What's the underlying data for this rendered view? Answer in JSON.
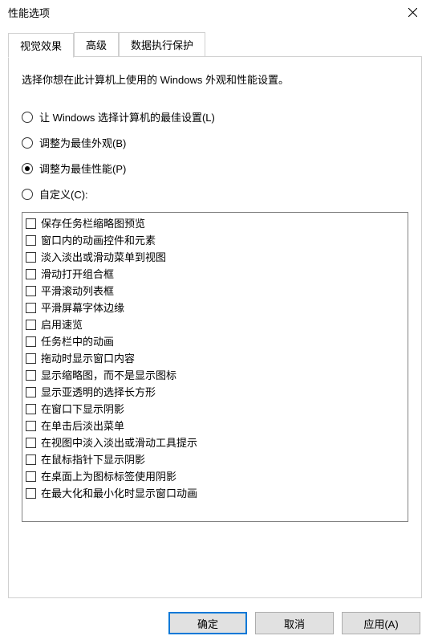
{
  "window": {
    "title": "性能选项"
  },
  "tabs": {
    "visual": "视觉效果",
    "advanced": "高级",
    "dep": "数据执行保护"
  },
  "desc": "选择你想在此计算机上使用的 Windows 外观和性能设置。",
  "radios": {
    "let_windows": "让 Windows 选择计算机的最佳设置(L)",
    "best_appearance": "调整为最佳外观(B)",
    "best_performance": "调整为最佳性能(P)",
    "custom": "自定义(C):",
    "selected": "best_performance"
  },
  "checks": [
    "保存任务栏缩略图预览",
    "窗口内的动画控件和元素",
    "淡入淡出或滑动菜单到视图",
    "滑动打开组合框",
    "平滑滚动列表框",
    "平滑屏幕字体边缘",
    "启用速览",
    "任务栏中的动画",
    "拖动时显示窗口内容",
    "显示缩略图，而不是显示图标",
    "显示亚透明的选择长方形",
    "在窗口下显示阴影",
    "在单击后淡出菜单",
    "在视图中淡入淡出或滑动工具提示",
    "在鼠标指针下显示阴影",
    "在桌面上为图标标签使用阴影",
    "在最大化和最小化时显示窗口动画"
  ],
  "buttons": {
    "ok": "确定",
    "cancel": "取消",
    "apply": "应用(A)"
  }
}
